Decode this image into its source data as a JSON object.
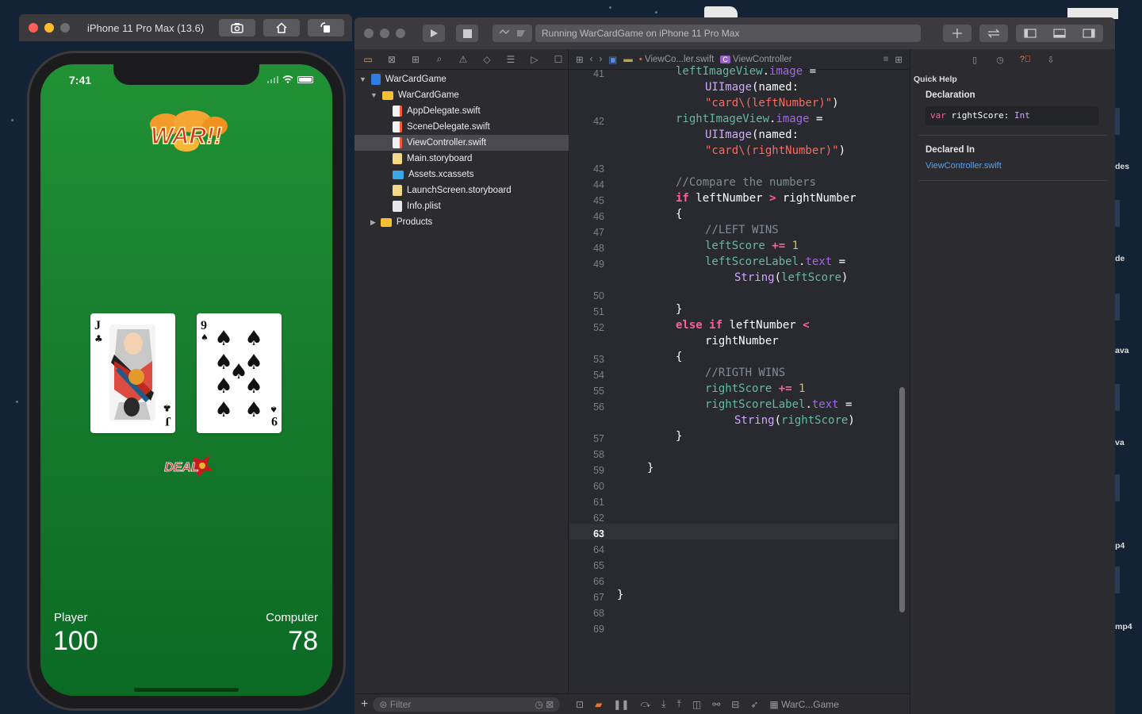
{
  "simulator": {
    "title": "iPhone 11 Pro Max (13.6)",
    "toolbar_icons": [
      "screenshot-icon",
      "home-icon",
      "rotate-icon"
    ],
    "status_time": "7:41",
    "logo_text": "WAR!!",
    "left_card": {
      "rank": "J",
      "suit": "clubs"
    },
    "right_card": {
      "rank": "9",
      "suit": "spades"
    },
    "deal_button": "DEAL",
    "player_label": "Player",
    "player_score": "100",
    "computer_label": "Computer",
    "computer_score": "78"
  },
  "xcode": {
    "activity": "Running WarCardGame on iPhone 11 Pro Max",
    "navigator": {
      "items": [
        {
          "label": "WarCardGame",
          "kind": "project"
        },
        {
          "label": "WarCardGame",
          "kind": "folder"
        },
        {
          "label": "AppDelegate.swift",
          "kind": "swift"
        },
        {
          "label": "SceneDelegate.swift",
          "kind": "swift"
        },
        {
          "label": "ViewController.swift",
          "kind": "swift",
          "selected": true
        },
        {
          "label": "Main.storyboard",
          "kind": "storyboard"
        },
        {
          "label": "Assets.xcassets",
          "kind": "assets"
        },
        {
          "label": "LaunchScreen.storyboard",
          "kind": "storyboard"
        },
        {
          "label": "Info.plist",
          "kind": "plist"
        },
        {
          "label": "Products",
          "kind": "folder"
        }
      ],
      "filter_placeholder": "Filter"
    },
    "jumpbar": {
      "file": "ViewCo...ler.swift",
      "symbol": "ViewController"
    },
    "code": {
      "current_line": "63",
      "line_numbers": [
        "41",
        "42",
        "43",
        "44",
        "45",
        "46",
        "47",
        "48",
        "49",
        "50",
        "51",
        "52",
        "53",
        "54",
        "55",
        "56",
        "57",
        "58",
        "59",
        "60",
        "61",
        "62",
        "63",
        "64",
        "65",
        "66",
        "67",
        "68",
        "69"
      ]
    },
    "debug_scheme": "WarC...Game",
    "quick_help": {
      "title": "Quick Help",
      "declaration_heading": "Declaration",
      "declaration_kw": "var",
      "declaration_name": " rightScore: ",
      "declaration_type": "Int",
      "declared_in_heading": "Declared In",
      "declared_in_link": "ViewController.swift"
    }
  },
  "desktop": {
    "labels": [
      "des",
      "de",
      "ava",
      "va",
      "p4",
      "mp4"
    ]
  },
  "colors": {
    "keyword": "#fc5fa3",
    "comment": "#7f8c98",
    "string": "#fc6a5d",
    "number": "#d0bf69",
    "link": "#4ea2ff",
    "felt_green": "#1a8a30"
  }
}
